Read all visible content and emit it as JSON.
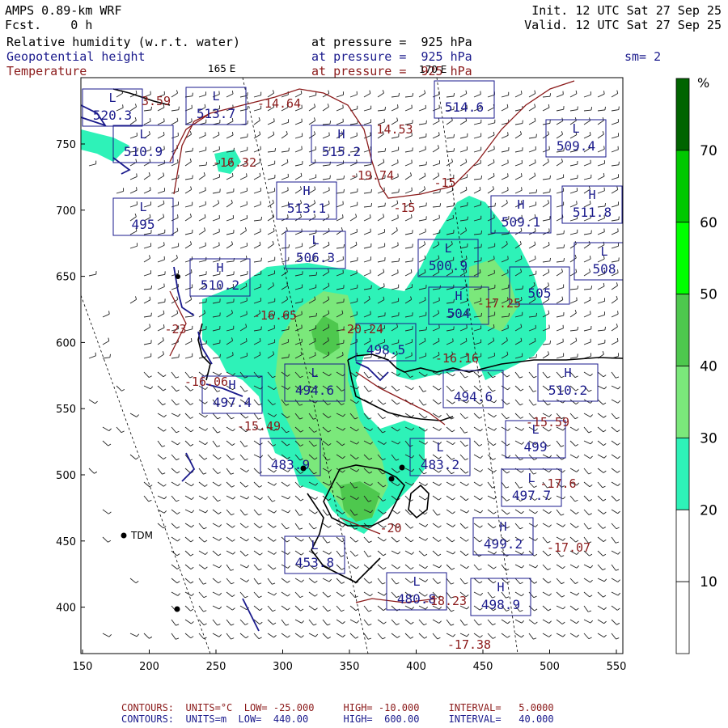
{
  "header": {
    "model": "AMPS 0.89-km WRF",
    "fcst": "Fcst.    0 h",
    "init": "Init. 12 UTC Sat 27 Sep 25",
    "valid": "Valid. 12 UTC Sat 27 Sep 25",
    "fields": [
      {
        "name": "Relative humidity (w.r.t. water)",
        "level": "at pressure =  925 hPa",
        "color": "#000000"
      },
      {
        "name": "Geopotential height",
        "level": "at pressure =  925 hPa",
        "color": "#1a1a8c"
      },
      {
        "name": "Temperature",
        "level": "at pressure =  925 hPa",
        "color": "#8b1a1a"
      }
    ],
    "smoothing": "sm= 2",
    "lon_label_165": "165 E",
    "lon_label_170": "170 E"
  },
  "axes": {
    "x_ticks": [
      "150",
      "200",
      "250",
      "300",
      "350",
      "400",
      "450",
      "500",
      "550"
    ],
    "y_ticks": [
      "750",
      "700",
      "650",
      "600",
      "550",
      "500",
      "450",
      "400"
    ]
  },
  "colorbar": {
    "unit": "%",
    "labels": [
      "70",
      "60",
      "50",
      "40",
      "30",
      "20",
      "10"
    ],
    "colors": [
      "#006400",
      "#00c800",
      "#00ff00",
      "#4ec84e",
      "#7be87b",
      "#2ef2b8",
      "#ffffff",
      "#ffffff",
      "#ffffff"
    ]
  },
  "stations": [
    {
      "name": "TDM"
    }
  ],
  "height_labels": [
    {
      "type": "L",
      "value": "520.3"
    },
    {
      "type": "L",
      "value": "513.7"
    },
    {
      "type": "",
      "value": "514.6"
    },
    {
      "type": "H",
      "value": "515.2"
    },
    {
      "type": "L",
      "value": "509.4"
    },
    {
      "type": "L",
      "value": "510.9"
    },
    {
      "type": "H",
      "value": "513.1"
    },
    {
      "type": "H",
      "value": "509.1"
    },
    {
      "type": "H",
      "value": "511.8"
    },
    {
      "type": "L",
      "value": "495"
    },
    {
      "type": "L",
      "value": "506.3"
    },
    {
      "type": "L",
      "value": "500.9"
    },
    {
      "type": "L",
      "value": "508"
    },
    {
      "type": "H",
      "value": "510.2"
    },
    {
      "type": "",
      "value": "505"
    },
    {
      "type": "H",
      "value": "504"
    },
    {
      "type": "",
      "value": "498.5"
    },
    {
      "type": "H",
      "value": "510.2"
    },
    {
      "type": "L",
      "value": "494.6"
    },
    {
      "type": "",
      "value": "494.6"
    },
    {
      "type": "H",
      "value": "497.4"
    },
    {
      "type": "L",
      "value": "499"
    },
    {
      "type": "",
      "value": "483.9"
    },
    {
      "type": "L",
      "value": "483.2"
    },
    {
      "type": "L",
      "value": "497.7"
    },
    {
      "type": "H",
      "value": "499.2"
    },
    {
      "type": "L",
      "value": "453.8"
    },
    {
      "type": "L",
      "value": "480.8"
    },
    {
      "type": "H",
      "value": "498.9"
    }
  ],
  "temperature_labels": [
    "3.59",
    "-14.64",
    "14.53",
    "-16.32",
    "-19.74",
    "-15",
    "-15",
    "-16.65",
    "-17.25",
    "-20.24",
    "-16.16",
    "-23",
    "-16.06",
    "-15.49",
    "-15.59",
    "-20",
    "-17.6",
    "-17.07",
    "-18.23",
    "-17.38"
  ],
  "footer": {
    "line1": "CONTOURS:  UNITS=°C  LOW= -25.000     HIGH= -10.000     INTERVAL=   5.0000",
    "line2": "CONTOURS:  UNITS=m  LOW=  440.00      HIGH=  600.00     INTERVAL=   40.000"
  }
}
